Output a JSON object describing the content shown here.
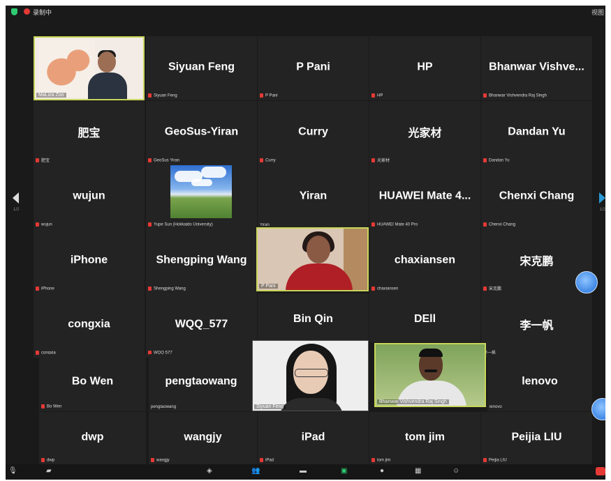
{
  "topbar": {
    "rec_label": "录制中",
    "view_label": "视图"
  },
  "pagination": {
    "left_num": "1/2",
    "right_num": "1/2"
  },
  "tiles": [
    {
      "id": "maliza",
      "type": "video",
      "label": "MaLiza Zoo",
      "active": true
    },
    {
      "id": "siyuan-feng",
      "name": "Siyuan Feng",
      "label": "Siyuan Feng"
    },
    {
      "id": "p-pani",
      "name": "P Pani",
      "label": "P Pani"
    },
    {
      "id": "hp",
      "name": "HP",
      "label": "HP"
    },
    {
      "id": "bhanwar",
      "name": "Bhanwar Vishve...",
      "label": "Bhanwar Vishvendra Raj Singh"
    },
    {
      "id": "feibao",
      "name": "肥宝",
      "label": "肥宝"
    },
    {
      "id": "geosus",
      "name": "GeoSus-Yiran",
      "label": "GeoSus Yiran"
    },
    {
      "id": "curry",
      "name": "Curry",
      "label": "Curry"
    },
    {
      "id": "guangjiacai",
      "name": "光家材",
      "label": "光家材"
    },
    {
      "id": "dandan",
      "name": "Dandan Yu",
      "label": "Dandan Yu"
    },
    {
      "id": "wujun",
      "name": "wujun",
      "label": "wujun"
    },
    {
      "id": "yupe-sun",
      "type": "image",
      "label": "Yupe Sun (Hokkaido University)"
    },
    {
      "id": "yiran",
      "name": "Yiran",
      "label": "Yiran"
    },
    {
      "id": "huawei",
      "name": "HUAWEI Mate 4...",
      "label": "HUAWEI Mate 40 Pro"
    },
    {
      "id": "chenxi",
      "name": "Chenxi Chang",
      "label": "Chenxi Chang"
    },
    {
      "id": "iphone",
      "name": "iPhone",
      "label": "iPhone"
    },
    {
      "id": "shengping",
      "name": "Shengping Wang",
      "label": "Shengping Wang"
    },
    {
      "id": "pani-video",
      "type": "video",
      "label": "P Pani",
      "active": true
    },
    {
      "id": "chaxiansen",
      "name": "chaxiansen",
      "label": "chaxiansen"
    },
    {
      "id": "songkepeng",
      "name": "宋克鹏",
      "label": "宋克鹏"
    },
    {
      "id": "congxia",
      "name": "congxia",
      "label": "congxia"
    },
    {
      "id": "wqq",
      "name": "WQQ_577",
      "label": "WQQ 577"
    },
    {
      "id": "binqin",
      "name": "Bin Qin",
      "label": ""
    },
    {
      "id": "dell",
      "name": "DEll",
      "label": ""
    },
    {
      "id": "liyifan",
      "name": "李一帆",
      "label": "李一帆"
    },
    {
      "id": "bowen",
      "name": "Bo Wen",
      "label": "Bo Wen"
    },
    {
      "id": "pengtaowang",
      "name": "pengtaowang",
      "label": "pengtaowang"
    },
    {
      "id": "feng-video",
      "type": "video",
      "label": "Siyuan Feng"
    },
    {
      "id": "bhanwar-video",
      "type": "video",
      "label": "Bhanwar Vishvendra Raj Singh",
      "active": true
    },
    {
      "id": "lenovo",
      "name": "lenovo",
      "label": "lenovo"
    },
    {
      "id": "dwp",
      "name": "dwp",
      "label": "dwp"
    },
    {
      "id": "wangjy",
      "name": "wangjy",
      "label": "wangjy"
    },
    {
      "id": "ipad",
      "name": "iPad",
      "label": "iPad"
    },
    {
      "id": "tomjim",
      "name": "tom jim",
      "label": "tom jim"
    },
    {
      "id": "peijia",
      "name": "Peijia LIU",
      "label": "Peijia LIU"
    }
  ],
  "icons": {
    "security": "shield-icon",
    "recording": "record-icon",
    "prev": "arrow-left-icon",
    "next": "arrow-right-icon",
    "mute": "mic-icon",
    "video": "camera-icon",
    "security_tb": "shield-icon",
    "participants": "people-icon",
    "chat": "chat-icon",
    "share": "share-screen-icon",
    "record_tb": "record-icon",
    "apps": "apps-icon",
    "reactions": "reactions-icon"
  },
  "colors": {
    "active_border": "#c8d65a",
    "mic_muted": "#e53935",
    "share": "#2ecc71"
  }
}
